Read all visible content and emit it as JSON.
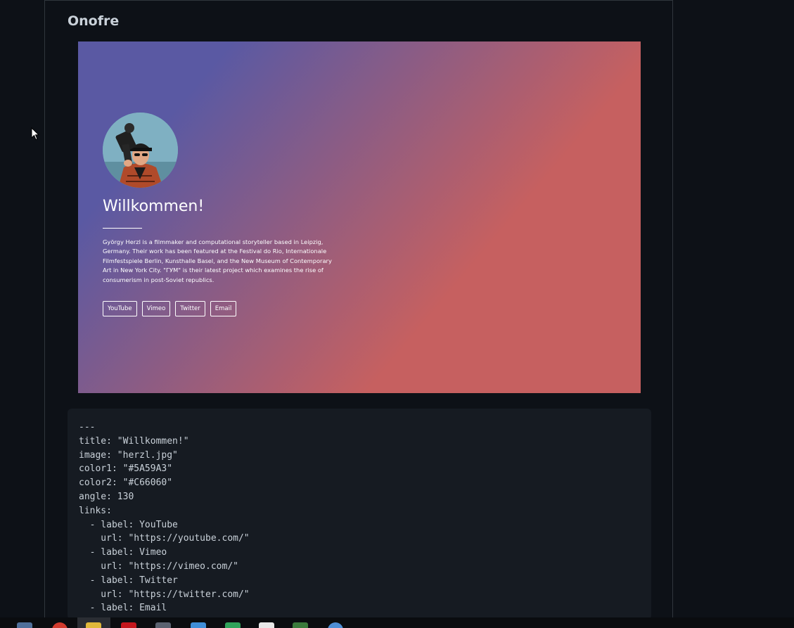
{
  "site": {
    "title": "Onofre"
  },
  "hero": {
    "title": "Willkommen!",
    "description": "György Herzl is a filmmaker and computational storyteller based in Leipzig, Germany. Their work has been featured at the Festival do Rio, Internationale Filmfestspiele Berlin, Kunsthalle Basel, and the New Museum of Contemporary Art in New York City. \"ГУМ\" is their latest project which examines the rise of consumerism in post-Soviet republics.",
    "color1": "#5A59A3",
    "color2": "#C66060",
    "avatar_icon": "person-with-camera-avatar",
    "links": [
      {
        "label": "YouTube"
      },
      {
        "label": "Vimeo"
      },
      {
        "label": "Twitter"
      },
      {
        "label": "Email"
      }
    ]
  },
  "code": {
    "content": "---\ntitle: \"Willkommen!\"\nimage: \"herzl.jpg\"\ncolor1: \"#5A59A3\"\ncolor2: \"#C66060\"\nangle: 130\nlinks:\n  - label: YouTube\n    url: \"https://youtube.com/\"\n  - label: Vimeo\n    url: \"https://vimeo.com/\"\n  - label: Twitter\n    url: \"https://twitter.com/\"\n  - label: Email"
  },
  "taskbar": {
    "icons": [
      "file-manager-icon",
      "browser-icon",
      "folder-icon",
      "pdf-icon",
      "settings-icon",
      "monitor-icon",
      "spreadsheet-icon",
      "notepad-icon",
      "terminal-icon",
      "network-icon"
    ]
  }
}
